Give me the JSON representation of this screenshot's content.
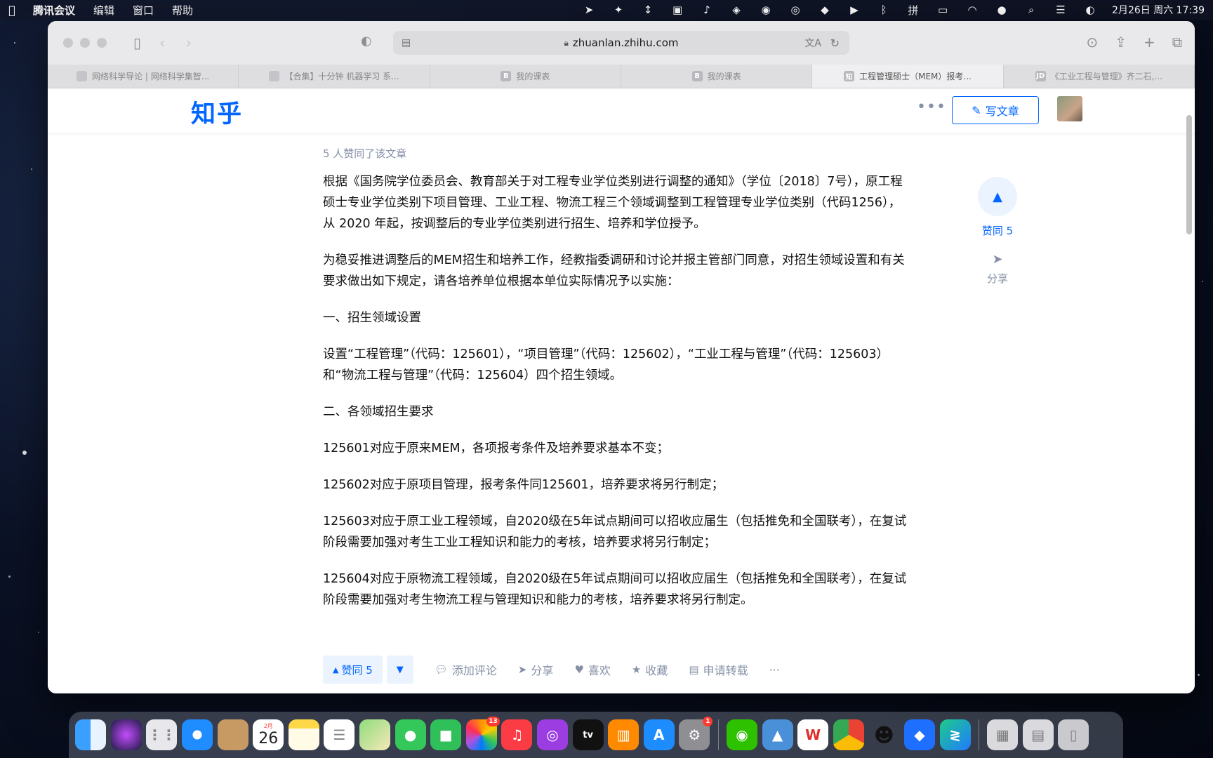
{
  "menubar": {
    "app_name": "腾讯会议",
    "menus": [
      "编辑",
      "窗口",
      "帮助"
    ],
    "clock": "2月26日 周六  17:39"
  },
  "browser": {
    "url": "zhuanlan.zhihu.com",
    "tabs": [
      {
        "label": "网络科学导论 | 网络科学集智...",
        "favicon": ""
      },
      {
        "label": "【合集】十分钟 机器学习 系...",
        "favicon": ""
      },
      {
        "label": "我的课表",
        "favicon": "B"
      },
      {
        "label": "我的课表",
        "favicon": "B"
      },
      {
        "label": "工程管理硕士（MEM）报考...",
        "favicon": "知"
      },
      {
        "label": "《工业工程与管理》齐二石,...",
        "favicon": "JD"
      }
    ],
    "active_tab_index": 4
  },
  "zhihu": {
    "logo": "知乎",
    "more": "•••",
    "write_button": "写文章"
  },
  "article": {
    "votes_note": "5 人赞同了该文章",
    "paragraphs": [
      "根据《国务院学位委员会、教育部关于对工程专业学位类别进行调整的通知》（学位〔2018〕7号），原工程硕士专业学位类别下项目管理、工业工程、物流工程三个领域调整到工程管理专业学位类别（代码1256），从 2020 年起，按调整后的专业学位类别进行招生、培养和学位授予。",
      "为稳妥推进调整后的MEM招生和培养工作，经教指委调研和讨论并报主管部门同意，对招生领域设置和有关要求做出如下规定，请各培养单位根据本单位实际情况予以实施：",
      "一、招生领域设置",
      "设置“工程管理”（代码：125601），“项目管理”（代码：125602），“工业工程与管理”（代码：125603）和“物流工程与管理”（代码：125604）四个招生领域。",
      "二、各领域招生要求",
      "125601对应于原来MEM，各项报考条件及培养要求基本不变；",
      "125602对应于原项目管理，报考条件同125601，培养要求将另行制定；",
      "125603对应于原工业工程领域，自2020级在5年试点期间可以招收应届生（包括推免和全国联考），在复试阶段需要加强对考生工业工程知识和能力的考核，培养要求将另行制定；",
      "125604对应于原物流工程领域，自2020级在5年试点期间可以招收应届生（包括推免和全国联考），在复试阶段需要加强对考生物流工程与管理知识和能力的考核，培养要求将另行制定。"
    ]
  },
  "side_actions": {
    "vote_label": "赞同 5",
    "share_label": "分享"
  },
  "bottom_actions": {
    "vote": "赞同 5",
    "comment": "添加评论",
    "share": "分享",
    "like": "喜欢",
    "collect": "收藏",
    "repost": "申请转载",
    "more": "···"
  },
  "dock": {
    "calendar_day": "26",
    "calendar_month": "2月",
    "badges": {
      "photos": "13",
      "settings": "1"
    }
  },
  "colors": {
    "zhihu_blue": "#0066ff",
    "muted_text": "#8590a6",
    "vote_bg": "#ebf3ff"
  }
}
